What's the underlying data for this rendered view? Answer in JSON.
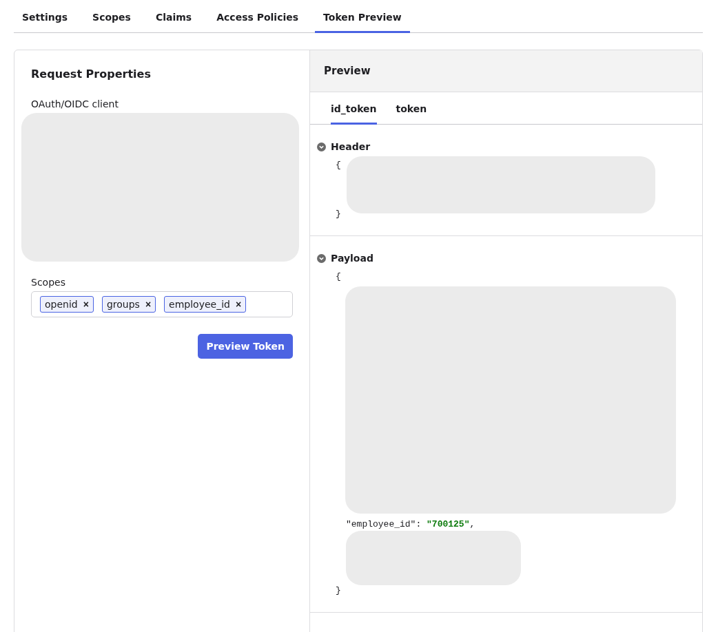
{
  "tabs": [
    {
      "label": "Settings",
      "selected": false
    },
    {
      "label": "Scopes",
      "selected": false
    },
    {
      "label": "Claims",
      "selected": false
    },
    {
      "label": "Access Policies",
      "selected": false
    },
    {
      "label": "Token Preview",
      "selected": true
    }
  ],
  "request": {
    "title": "Request Properties",
    "client_label": "OAuth/OIDC client",
    "scopes_label": "Scopes",
    "scopes": [
      {
        "label": "openid",
        "remove": "×"
      },
      {
        "label": "groups",
        "remove": "×"
      },
      {
        "label": "employee_id",
        "remove": "×"
      }
    ],
    "button": "Preview Token"
  },
  "preview": {
    "title": "Preview",
    "token_tabs": [
      {
        "label": "id_token",
        "selected": true
      },
      {
        "label": "token",
        "selected": false
      }
    ],
    "sections": [
      {
        "kind": "header",
        "title": "Header",
        "expanded": true,
        "open": "{",
        "close": "}"
      },
      {
        "kind": "payload",
        "title": "Payload",
        "expanded": true,
        "open": "{",
        "close": "}",
        "key": "\"employee_id\"",
        "separator": ": ",
        "value": "\"700125\"",
        "trailer": ","
      }
    ]
  }
}
